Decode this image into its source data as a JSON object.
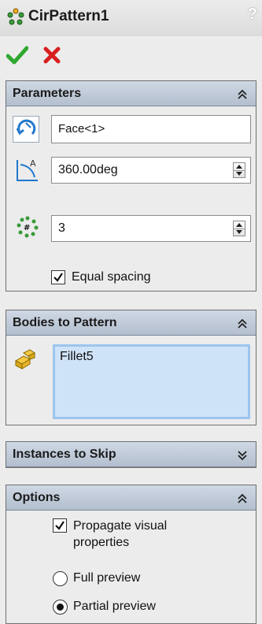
{
  "window": {
    "title": "CirPattern1",
    "help": "?"
  },
  "actions": {
    "ok_icon": "green-checkmark-icon",
    "cancel_icon": "red-x-icon"
  },
  "parameters": {
    "header": "Parameters",
    "axis_value": "Face<1>",
    "angle_value": "360.00deg",
    "instances_value": "3",
    "equal_spacing_label": "Equal spacing",
    "equal_spacing_checked": true
  },
  "bodies": {
    "header": "Bodies to Pattern",
    "items": [
      "Fillet5"
    ]
  },
  "instances_to_skip": {
    "header": "Instances to Skip"
  },
  "options": {
    "header": "Options",
    "propagate_label_line1": "Propagate visual",
    "propagate_label_line2": "properties",
    "propagate_checked": true,
    "full_preview_label": "Full preview",
    "partial_preview_label": "Partial preview",
    "selected_preview": "partial"
  },
  "colors": {
    "header_gradient_top": "#cfd8e4",
    "header_gradient_bottom": "#b3bfcf",
    "selection_fill": "#cfe3f8",
    "selection_border": "#9cc5ee",
    "ok_green": "#2fa82f",
    "cancel_red": "#d81e1e"
  }
}
